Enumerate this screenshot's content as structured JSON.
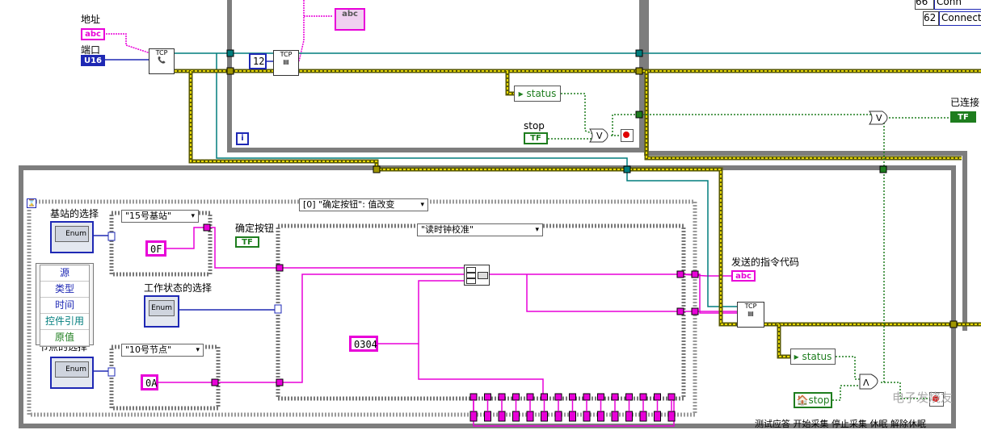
{
  "labels": {
    "address": "地址",
    "port": "端口",
    "stop": "stop",
    "connected": "已连接",
    "base_station_select": "基站的选择",
    "confirm_button": "确定按钮",
    "work_state_select": "工作状态的选择",
    "node_select": "节点的选择",
    "send_code": "发送的指令代码",
    "bottom_text": "测试应答   开始采集   停止采集   休眠      解除休眠"
  },
  "constants": {
    "loop_count": "12",
    "base_hex": "0F",
    "node_hex": "0A",
    "cmd_hex": "0304"
  },
  "terminals": {
    "abc": "abc",
    "u16": "U16",
    "tf": "TF",
    "enum": "Enum",
    "loop_i": "i",
    "status": "status",
    "stop_terminal": "stop",
    "tcp": "TCP"
  },
  "selectors": {
    "event_case": "[0] \"确定按钮\": 值改变",
    "base_case": "\"15号基站\"",
    "node_case": "\"10号节点\"",
    "inner_case": "\"读时钟校准\""
  },
  "event_items": [
    "源",
    "类型",
    "时间",
    "控件引用",
    "原值"
  ],
  "top_right": [
    {
      "num": "66",
      "text": "Conn"
    },
    {
      "num": "62",
      "text": "Connecti"
    }
  ],
  "watermark": "电子发烧友",
  "colors": {
    "string": "#e800d8",
    "numeric": "#1e28b4",
    "boolean": "#1e7d1e",
    "refnum": "#007d7d",
    "error": "#b4b400",
    "frame": "#7d7d7d"
  }
}
